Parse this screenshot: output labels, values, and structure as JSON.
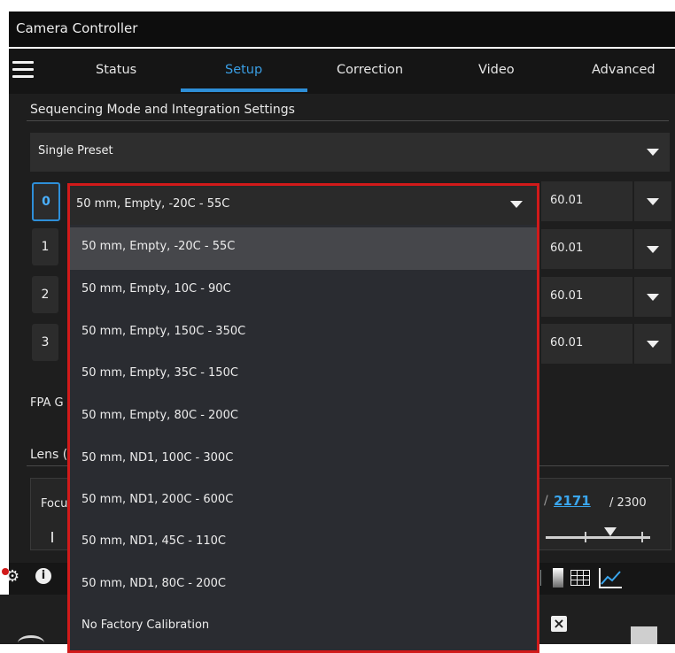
{
  "window": {
    "title": "Camera Controller"
  },
  "nav": {
    "tabs": [
      {
        "label": "Status"
      },
      {
        "label": "Setup"
      },
      {
        "label": "Correction"
      },
      {
        "label": "Video"
      },
      {
        "label": "Advanced"
      }
    ],
    "active_tab": "Setup",
    "menu_icon": "hamburger-menu-icon"
  },
  "setup": {
    "section_title": "Sequencing Mode and Integration Settings",
    "sequencing_mode": "Single Preset",
    "presets": [
      {
        "index": "0",
        "value": "60.01"
      },
      {
        "index": "1",
        "value": "60.01"
      },
      {
        "index": "2",
        "value": "60.01"
      },
      {
        "index": "3",
        "value": "60.01"
      }
    ],
    "fpa_label_partial": "FPA G",
    "lens_label_partial": "Lens (",
    "focus_label_partial": "Focu",
    "focus_value": "2171",
    "focus_max": "/ 2300",
    "preset_separator": "/"
  },
  "dropdown": {
    "selected": "50 mm, Empty, -20C - 55C",
    "options": [
      "50 mm, Empty, -20C - 55C",
      "50 mm, Empty, 10C - 90C",
      "50 mm, Empty, 150C - 350C",
      "50 mm, Empty, 35C - 150C",
      "50 mm, Empty, 80C - 200C",
      "50 mm, ND1, 100C - 300C",
      "50 mm, ND1, 200C - 600C",
      "50 mm, ND1, 45C - 110C",
      "50 mm, ND1, 80C - 200C",
      "No Factory Calibration"
    ]
  },
  "colors": {
    "accent": "#2e8fd8",
    "highlight_border": "#d11a1a"
  },
  "toolbar": {
    "icons": [
      "gear-icon",
      "info-icon",
      "colorbar-icon",
      "grid-icon",
      "chart-icon",
      "close-box-icon"
    ]
  }
}
